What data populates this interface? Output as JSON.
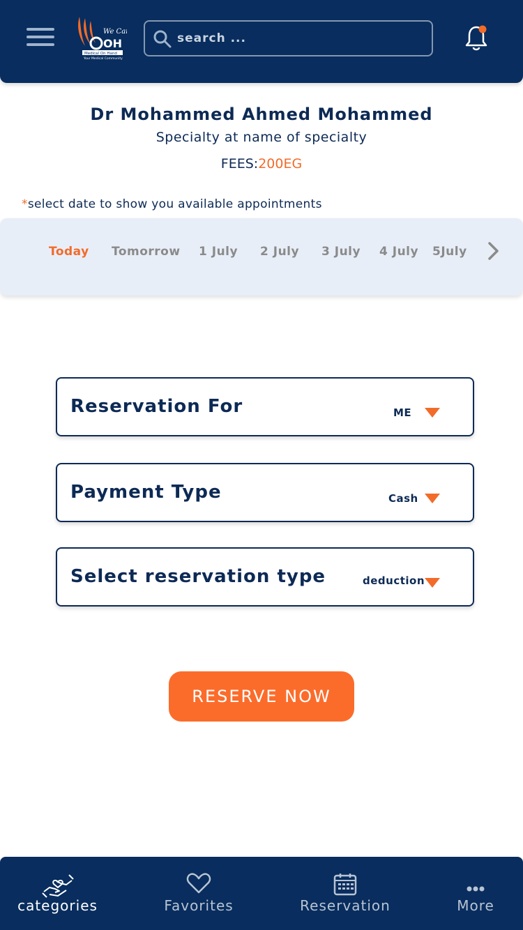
{
  "header": {
    "search_placeholder": "search ...",
    "logo_text": "We Care MOH Medical On Hand Your Medical Community"
  },
  "doctor": {
    "name": "Dr Mohammed Ahmed Mohammed",
    "specialty": "Specialty at name of specialty",
    "fees_label": "FEES:",
    "fees_value": "200EG"
  },
  "hint": {
    "star": "*",
    "text": "select date to show you available appointments"
  },
  "dates": [
    {
      "label": "Today",
      "active": true
    },
    {
      "label": "Tomorrow",
      "active": false
    },
    {
      "label": "1 July",
      "active": false
    },
    {
      "label": "2 July",
      "active": false
    },
    {
      "label": "3 July",
      "active": false
    },
    {
      "label": "4 July",
      "active": false
    },
    {
      "label": "5July",
      "active": false
    }
  ],
  "fields": {
    "reservation_for": {
      "label": "Reservation For",
      "value": "ME"
    },
    "payment_type": {
      "label": "Payment Type",
      "value": "Cash"
    },
    "reservation_type": {
      "label": "Select reservation type",
      "value": "deduction"
    }
  },
  "reserve_button": "RESERVE NOW",
  "bottom_nav": [
    {
      "label": "categories",
      "icon": "categories-icon",
      "active": true
    },
    {
      "label": "Favorites",
      "icon": "heart-icon",
      "active": false
    },
    {
      "label": "Reservation",
      "icon": "calendar-icon",
      "active": false
    },
    {
      "label": "More",
      "icon": "more-icon",
      "active": false
    }
  ],
  "colors": {
    "primary": "#082d5e",
    "accent": "#fb6c2b",
    "date_strip": "#e8eef8"
  }
}
